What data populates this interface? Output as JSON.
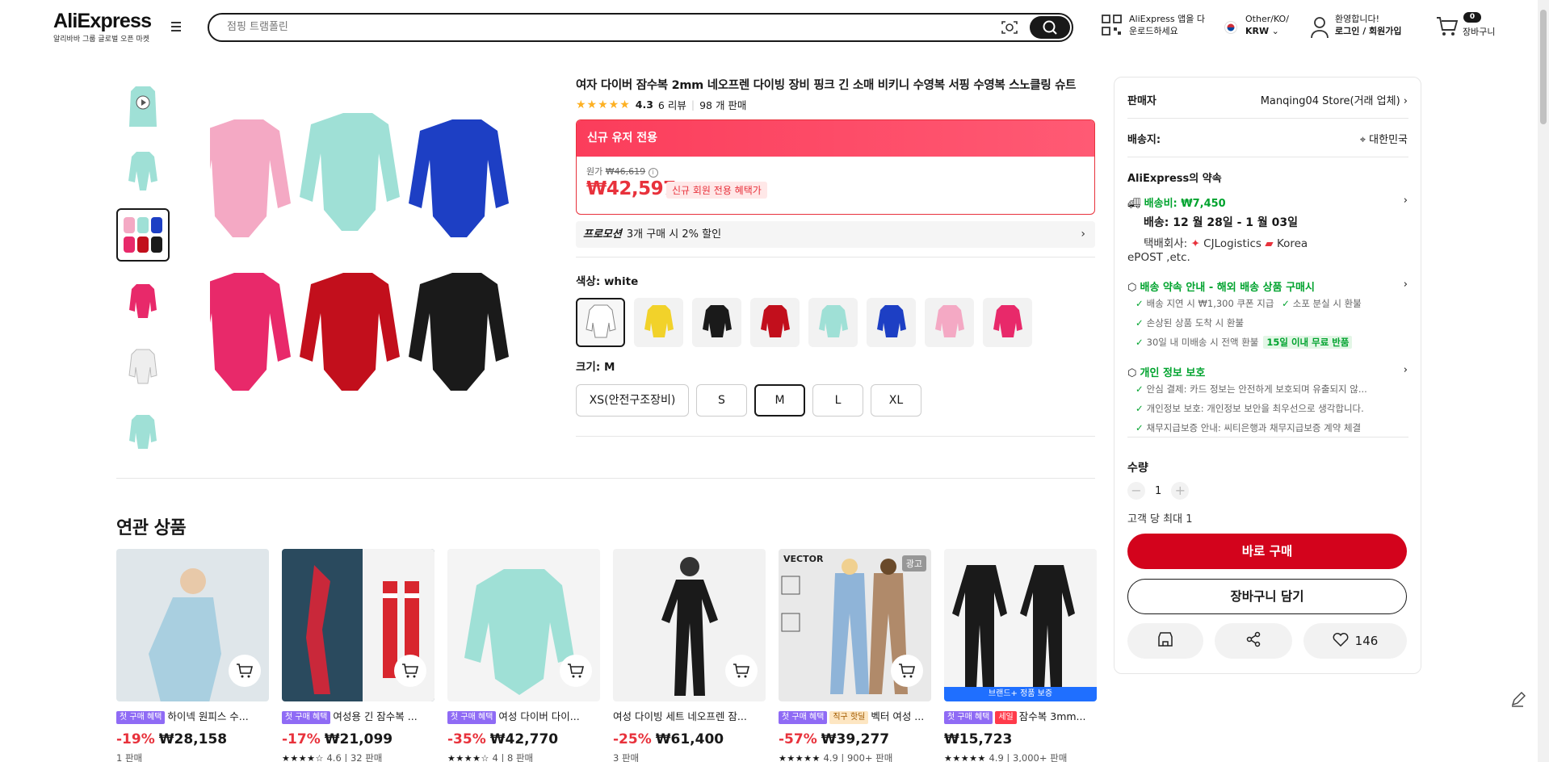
{
  "header": {
    "logo": "AliExpress",
    "logo_sub": "알리바바 그룹 글로벌 오픈 마켓",
    "search_placeholder": "점핑 트램폴린",
    "app_line1": "AliExpress 앱을 다",
    "app_line2": "운로드하세요",
    "region_line1": "Other/KO/",
    "region_line2": "KRW",
    "account_line1": "환영합니다!",
    "account_line2": "로그인 / 회원가입",
    "cart_count": "0",
    "cart_label": "장바구니"
  },
  "product": {
    "title": "여자 다이버 잠수복 2mm 네오프렌 다이빙 장비 핑크 긴 소매 비키니 수영복 서핑 수영복 스노클링 슈트",
    "rating": "4.3",
    "reviews": "6 리뷰",
    "sold": "98 개 판매",
    "banner": "신규 유저 전용",
    "orig_label": "원가",
    "orig_price": "₩46,619",
    "sale_price": "₩42,597",
    "member_badge": "신규 회원 전용 혜택가",
    "promo_label": "프로모션",
    "promo_text": "3개 구매 시 2% 할인",
    "color_label": "색상:",
    "color_value": "white",
    "size_label": "크기:",
    "size_value": "M",
    "sizes": [
      "XS(안전구조장비)",
      "S",
      "M",
      "L",
      "XL"
    ],
    "swatch_colors": [
      "#f0f0f0",
      "#f2d22a",
      "#1a1a1a",
      "#c20f1c",
      "#9fe0d6",
      "#1d3fc4",
      "#f4a9c4",
      "#e8296a"
    ]
  },
  "related": {
    "title": "연관 상품",
    "items": [
      {
        "tags": [
          "첫 구매 혜택"
        ],
        "name": "하이넥 원피스 수...",
        "discount": "-19%",
        "price": "₩28,158",
        "sold": "1 판매",
        "stars": ""
      },
      {
        "tags": [
          "첫 구매 혜택"
        ],
        "name": "여성용 긴 잠수복 ...",
        "discount": "-17%",
        "price": "₩21,099",
        "sold": "4.6 | 32 판매",
        "stars": "★★★★☆"
      },
      {
        "tags": [
          "첫 구매 혜택"
        ],
        "name": "여성 다이버 다이...",
        "discount": "-35%",
        "price": "₩42,770",
        "sold": "4 | 8 판매",
        "stars": "★★★★☆"
      },
      {
        "tags": [],
        "name": "여성 다이빙 세트 네오프렌 잠...",
        "discount": "-25%",
        "price": "₩61,400",
        "sold": "3 판매",
        "stars": ""
      },
      {
        "tags": [
          "첫 구매 혜택",
          "직구 핫딜"
        ],
        "name": "벡터 여성 ...",
        "discount": "-57%",
        "price": "₩39,277",
        "sold": "4.9 | 900+ 판매",
        "stars": "★★★★★",
        "ad": "광고",
        "brand": "VECTOR"
      },
      {
        "tags": [
          "첫 구매 혜택",
          "세일"
        ],
        "name": "잠수복 3mm...",
        "discount": "",
        "price": "₩15,723",
        "sold": "4.9 | 3,000+ 판매",
        "stars": "★★★★★",
        "strip": "브랜드+ 정품 보증"
      }
    ]
  },
  "panel": {
    "seller_label": "판매자",
    "seller_value": "Manqing04 Store(거래 업체)",
    "ship_to_label": "배송지:",
    "ship_to_value": "대한민국",
    "promise_title": "AliExpress의 약속",
    "shipping_fee": "배송비: ₩7,450",
    "delivery": "배송: 12 월 28일 - 1 월 03일",
    "carrier_line1": "택배회사:",
    "carrier_a": "CJLogistics",
    "carrier_b": "Korea",
    "carrier_line2": "ePOST ,etc.",
    "guarantee_title": "배송 약속 안내 - 해외 배송 상품 구매시",
    "guarantee_1a": "배송 지연 시 ₩1,300 쿠폰 지급",
    "guarantee_1b": "소포 분실 시 환불",
    "guarantee_2": "손상된 상품 도착 시 환불",
    "guarantee_3": "30일 내 미배송 시 전액 환불",
    "guarantee_3_badge": "15일 이내 무료 반품",
    "privacy_title": "개인 정보 보호",
    "privacy_1": "안심 결제: 카드 정보는 안전하게 보호되며 유출되지 않...",
    "privacy_2": "개인정보 보호: 개인정보 보안을 최우선으로 생각합니다.",
    "privacy_3": "채무지급보증 안내: 씨티은행과 채무지급보증 계약 체결",
    "qty_label": "수량",
    "qty_value": "1",
    "qty_limit": "고객 당 최대 1",
    "buy_now": "바로 구매",
    "add_to_cart": "장바구니 담기",
    "wish_count": "146"
  }
}
